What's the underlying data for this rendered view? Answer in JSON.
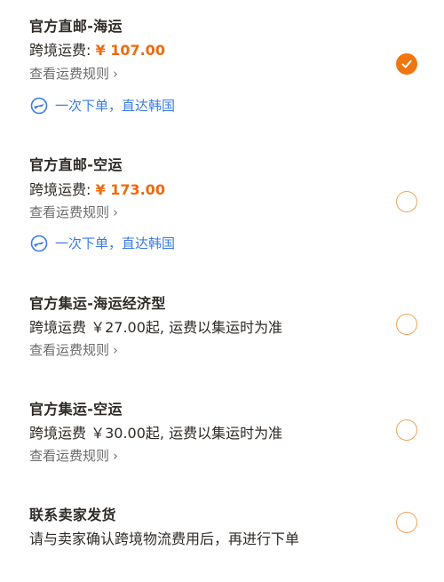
{
  "options": [
    {
      "title": "官方直邮-海运",
      "fee_label": "跨境运费:",
      "fee_price": "¥ 107.00",
      "rule_link": "查看运费规则",
      "promo": "一次下单，直达韩国",
      "selected": true
    },
    {
      "title": "官方直邮-空运",
      "fee_label": "跨境运费:",
      "fee_price": "¥ 173.00",
      "rule_link": "查看运费规则",
      "promo": "一次下单，直达韩国",
      "selected": false
    },
    {
      "title": "官方集运-海运经济型",
      "fee_text": "跨境运费 ￥27.00起, 运费以集运时为准",
      "rule_link": "查看运费规则",
      "selected": false
    },
    {
      "title": "官方集运-空运",
      "fee_text": "跨境运费 ￥30.00起, 运费以集运时为准",
      "rule_link": "查看运费规则",
      "selected": false
    },
    {
      "title": "联系卖家发货",
      "fee_text": "请与卖家确认跨境物流费用后，再进行下单",
      "selected": false
    }
  ],
  "icons": {
    "rule_chevron": "chevron-right-icon",
    "promo": "plane-circle-icon",
    "selected": "check-icon"
  },
  "colors": {
    "price": "#f06a0f",
    "promo": "#3b7be3",
    "radio_selected": "#f0760f",
    "radio_border": "#f0a35a"
  }
}
